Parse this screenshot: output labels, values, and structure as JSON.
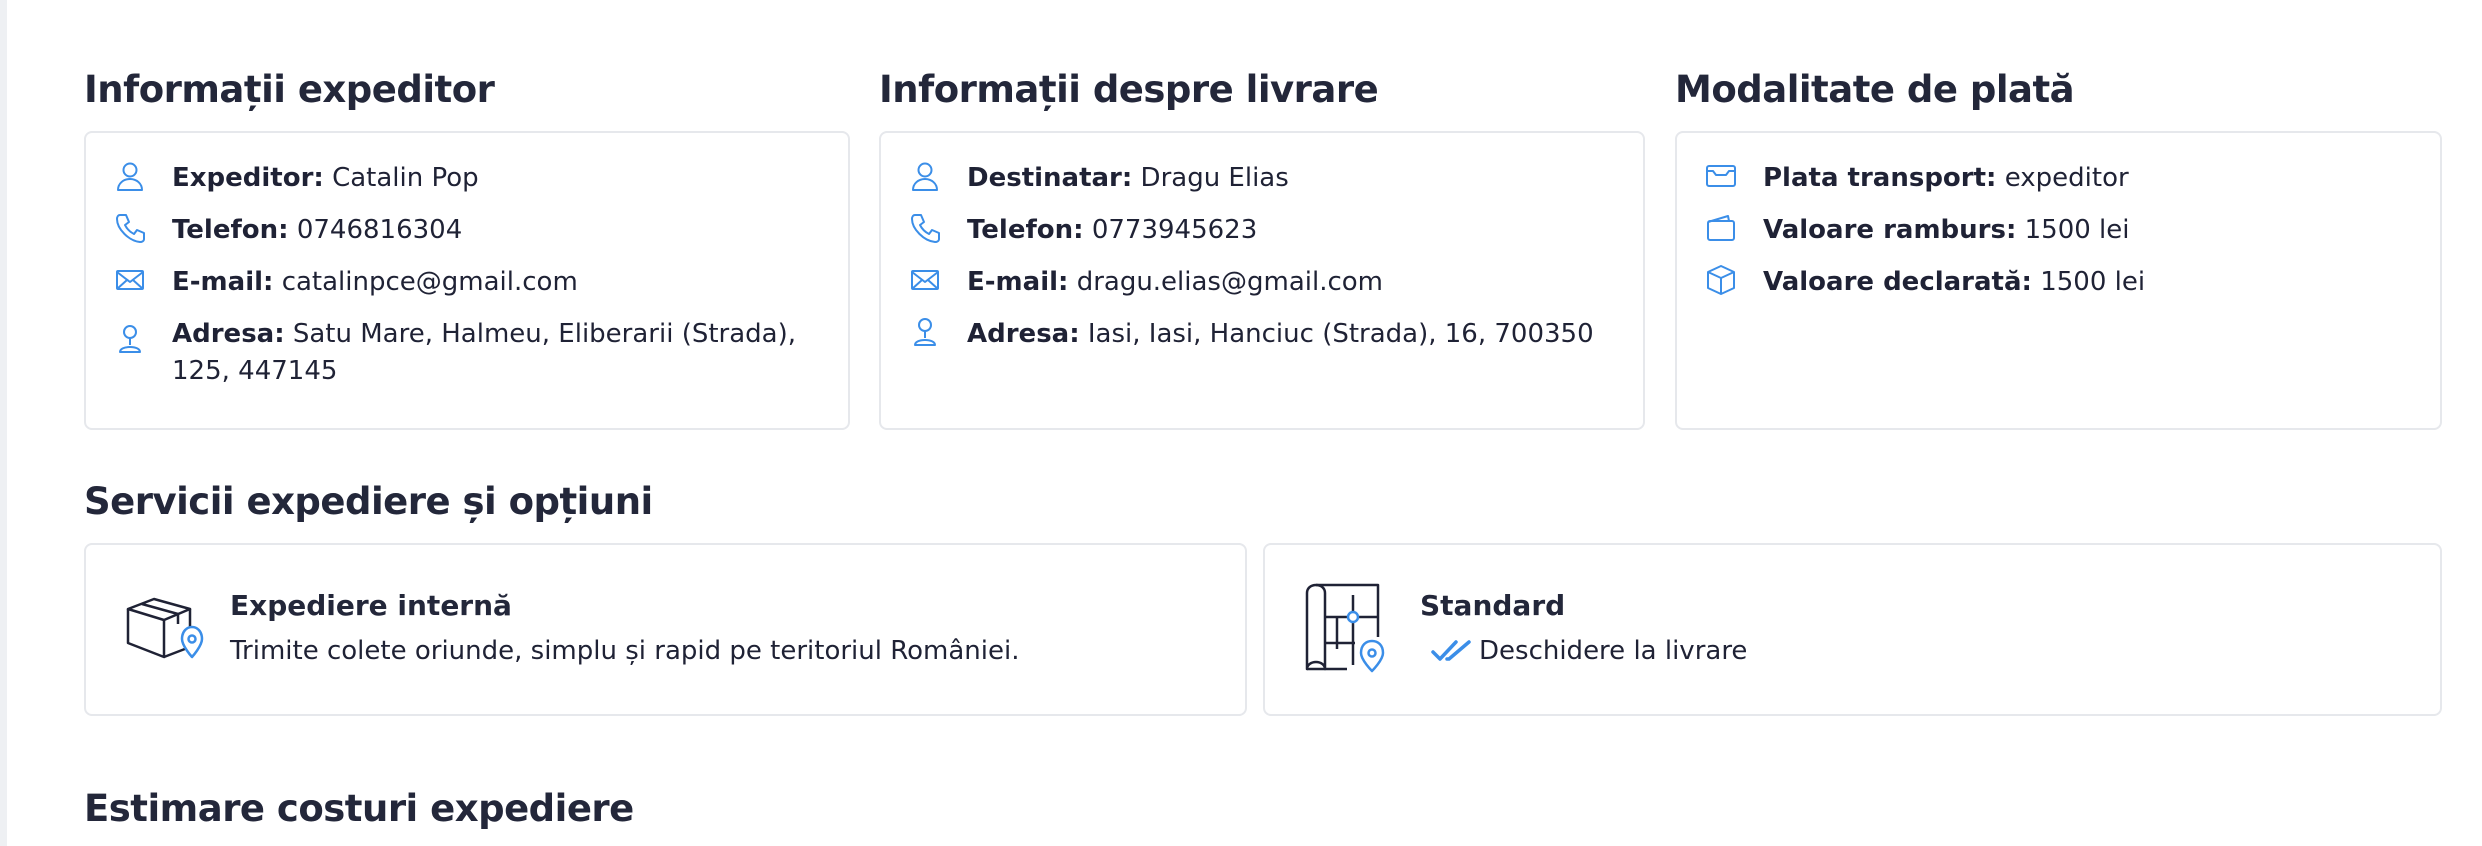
{
  "sections": {
    "sender_title": "Informații expeditor",
    "delivery_title": "Informații despre livrare",
    "payment_title": "Modalitate de plată",
    "services_title": "Servicii expediere și opțiuni",
    "estimate_title": "Estimare costuri expediere"
  },
  "sender": {
    "name_label": "Expeditor:",
    "name": "Catalin Pop",
    "phone_label": "Telefon:",
    "phone": "0746816304",
    "email_label": "E-mail:",
    "email": "catalinpce@gmail.com",
    "address_label": "Adresa:",
    "address": "Satu Mare, Halmeu, Eliberarii (Strada), 125, 447145"
  },
  "recipient": {
    "name_label": "Destinatar:",
    "name": "Dragu Elias",
    "phone_label": "Telefon:",
    "phone": "0773945623",
    "email_label": "E-mail:",
    "email": "dragu.elias@gmail.com",
    "address_label": "Adresa:",
    "address": "Iasi, Iasi, Hanciuc (Strada), 16, 700350"
  },
  "payment": {
    "transport_label": "Plata transport:",
    "transport": "expeditor",
    "cod_label": "Valoare ramburs:",
    "cod": "1500 lei",
    "declared_label": "Valoare declarată:",
    "declared": "1500 lei"
  },
  "services": {
    "domestic_title": "Expediere internă",
    "domestic_desc": "Trimite colete oriunde, simplu și rapid pe teritoriul României.",
    "standard_title": "Standard",
    "option_open_on_delivery": "Deschidere la livrare"
  },
  "colors": {
    "accent": "#3b8ee8",
    "heading": "#23273a",
    "border": "#e6e8ec"
  }
}
